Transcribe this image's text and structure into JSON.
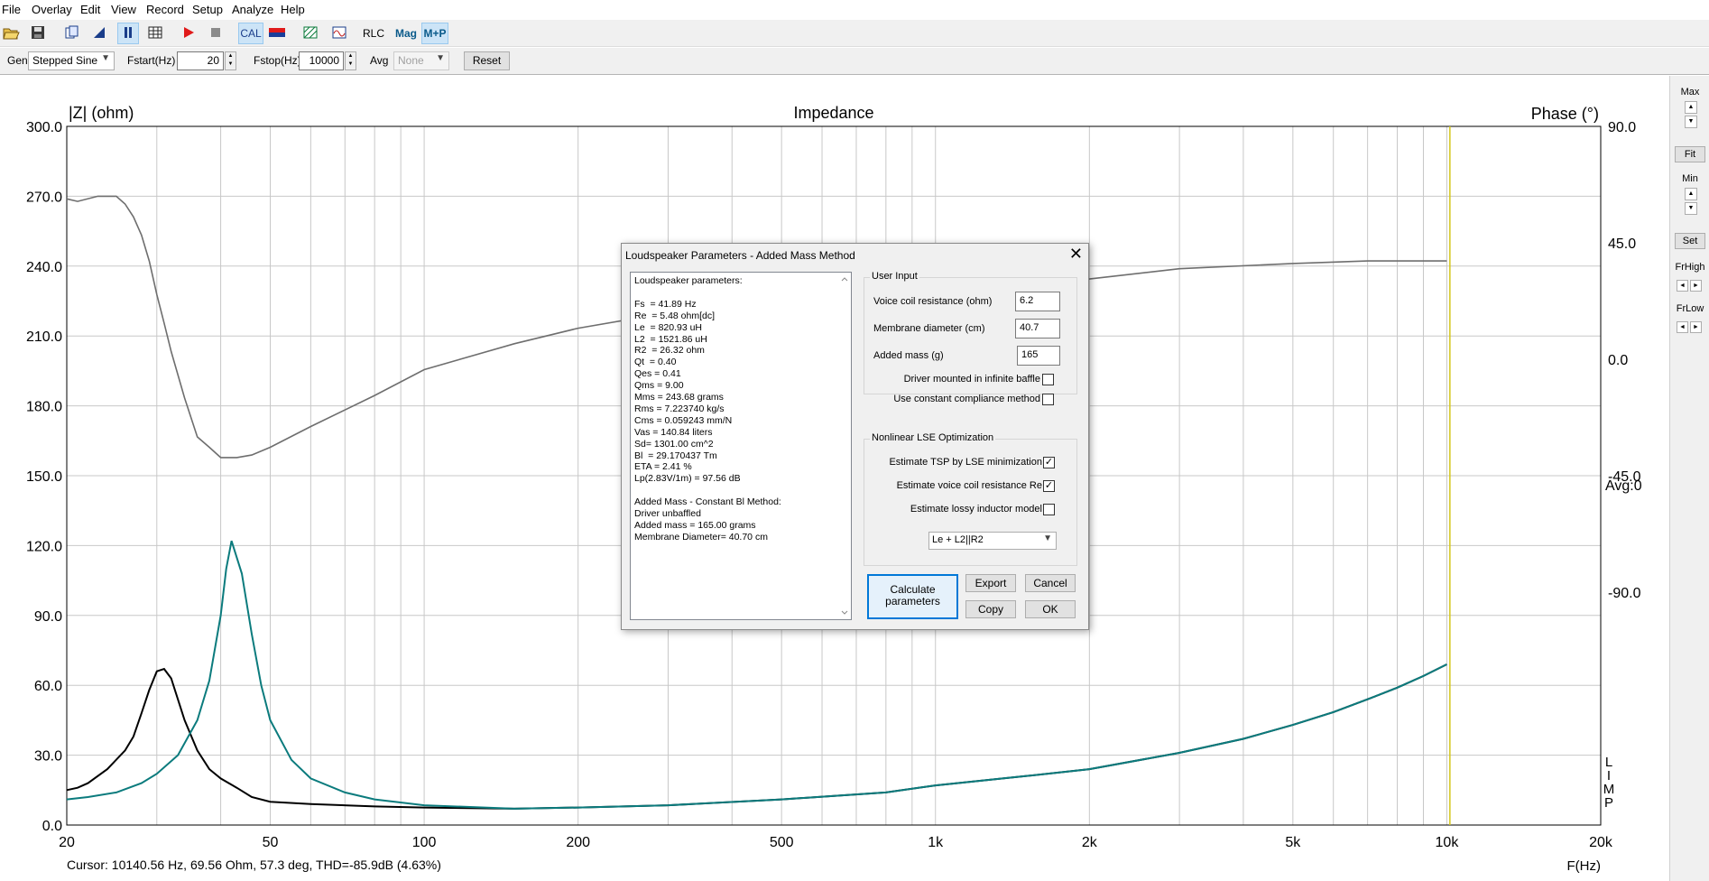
{
  "menu": [
    "File",
    "Overlay",
    "Edit",
    "View",
    "Record",
    "Setup",
    "Analyze",
    "Help"
  ],
  "toolbar": {
    "cal": "CAL",
    "rlc": "RLC",
    "mag": "Mag",
    "mp": "M+P"
  },
  "genbar": {
    "gen_label": "Gen",
    "gen_value": "Stepped Sine",
    "fstart_label": "Fstart(Hz)",
    "fstart_value": "20",
    "fstop_label": "Fstop(Hz)",
    "fstop_value": "10000",
    "avg_label": "Avg",
    "avg_value": "None",
    "reset": "Reset"
  },
  "chart_data": {
    "type": "line",
    "title": "Impedance",
    "ylabel": "|Z| (ohm)",
    "ylabel_right": "Phase (°)",
    "xlabel": "F(Hz)",
    "xscale": "log",
    "xlim": [
      20,
      20000
    ],
    "ylim": [
      0,
      300
    ],
    "ylim_right": [
      -180,
      90
    ],
    "x_ticks": [
      "20",
      "50",
      "100",
      "200",
      "500",
      "1k",
      "2k",
      "5k",
      "10k",
      "20k"
    ],
    "y_ticks": [
      "300.0",
      "270.0",
      "240.0",
      "210.0",
      "180.0",
      "150.0",
      "120.0",
      "90.0",
      "60.0",
      "30.0",
      "0.0"
    ],
    "y_right_ticks": [
      "90.0",
      "45.0",
      "0.0",
      "-45.0",
      "-90.0"
    ],
    "avg_text": "Avg:0",
    "limp_text": "LIMP",
    "cursor_hz": 10140.56,
    "series": [
      {
        "color": "#000000",
        "x": [
          20,
          21,
          22,
          24,
          26,
          27,
          28,
          29,
          30,
          31,
          32,
          34,
          36,
          38,
          40,
          43,
          46,
          50,
          60,
          80,
          100,
          150,
          200,
          300,
          500,
          800,
          1000,
          1500,
          2000,
          3000,
          4000,
          5000,
          6000,
          7000,
          8000,
          9000,
          10000
        ],
        "y": [
          15,
          16,
          18,
          24,
          32,
          38,
          48,
          58,
          66,
          67,
          63,
          45,
          32,
          24,
          20,
          16,
          12,
          10,
          9,
          8,
          7.5,
          7,
          7.5,
          8.5,
          11,
          14,
          17,
          21,
          24,
          31,
          37,
          43,
          48.5,
          54,
          59,
          64,
          69
        ]
      },
      {
        "color": "#0b7b7d",
        "x": [
          20,
          22,
          25,
          28,
          30,
          33,
          36,
          38,
          40,
          41,
          42,
          44,
          46,
          48,
          50,
          55,
          60,
          70,
          80,
          100,
          150,
          200,
          300,
          500,
          800,
          1000,
          1500,
          2000,
          3000,
          4000,
          5000,
          6000,
          7000,
          8000,
          9000,
          10000
        ],
        "y": [
          11,
          12,
          14,
          18,
          22,
          30,
          45,
          62,
          90,
          110,
          122,
          108,
          82,
          60,
          45,
          28,
          20,
          14,
          11,
          8.5,
          7,
          7.5,
          8.5,
          11,
          14,
          17,
          21,
          24,
          31,
          37,
          43,
          48.5,
          54,
          59,
          64,
          69
        ]
      },
      {
        "color": "#6e6e6e",
        "axis": "phase",
        "x": [
          20,
          21,
          23,
          25,
          26,
          27,
          28,
          29,
          30,
          31,
          32,
          34,
          36,
          38,
          40,
          43,
          46,
          50,
          60,
          80,
          100,
          150,
          200,
          300,
          400,
          500,
          700,
          900,
          1000,
          1100,
          1200,
          1500,
          2000,
          3000,
          5000,
          7000,
          10000
        ],
        "y": [
          62,
          61,
          63,
          63,
          60,
          55,
          48,
          38,
          25,
          14,
          3,
          -15,
          -30,
          -34,
          -38,
          -38,
          -37,
          -34,
          -26,
          -14,
          -4,
          6,
          12,
          18,
          20,
          22,
          22,
          25,
          26,
          22,
          25,
          27,
          31,
          35,
          37,
          38,
          38
        ]
      }
    ]
  },
  "right_panel": {
    "max": "Max",
    "fit": "Fit",
    "min": "Min",
    "set": "Set",
    "frhigh": "FrHigh",
    "frlow": "FrLow"
  },
  "dialog": {
    "title": "Loudspeaker Parameters - Added Mass Method",
    "param_lines": [
      "Loudspeaker parameters:",
      "",
      "Fs  = 41.89 Hz",
      "Re  = 5.48 ohm[dc]",
      "Le  = 820.93 uH",
      "L2  = 1521.86 uH",
      "R2  = 26.32 ohm",
      "Qt  = 0.40",
      "Qes = 0.41",
      "Qms = 9.00",
      "Mms = 243.68 grams",
      "Rms = 7.223740 kg/s",
      "Cms = 0.059243 mm/N",
      "Vas = 140.84 liters",
      "Sd= 1301.00 cm^2",
      "Bl  = 29.170437 Tm",
      "ETA = 2.41 %",
      "Lp(2.83V/1m) = 97.56 dB",
      "",
      "Added Mass - Constant Bl Method:",
      "Driver unbaffled",
      "Added mass = 165.00 grams",
      "Membrane Diameter= 40.70 cm"
    ],
    "user_input": {
      "title": "User Input",
      "vc_label": "Voice coil resistance (ohm)",
      "vc_value": "6.2",
      "md_label": "Membrane diameter (cm)",
      "md_value": "40.7",
      "am_label": "Added mass (g)",
      "am_value": "165",
      "baffle_label": "Driver mounted in infinite baffle",
      "const_label": "Use constant compliance method"
    },
    "nonlinear": {
      "title": "Nonlinear LSE Optimization",
      "tsp_label": "Estimate TSP by LSE minimization",
      "re_label": "Estimate voice coil resistance Re",
      "lossy_label": "Estimate lossy inductor model",
      "model_value": "Le + L2||R2"
    },
    "check_mark": "✓",
    "buttons": {
      "calc": "Calculate parameters",
      "export": "Export",
      "cancel": "Cancel",
      "copy": "Copy",
      "ok": "OK"
    }
  },
  "status": {
    "cursor": "Cursor: 10140.56 Hz, 69.56 Ohm, 57.3 deg, THD=-85.9dB (4.63%)"
  }
}
